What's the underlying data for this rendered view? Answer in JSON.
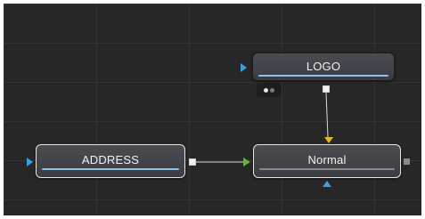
{
  "nodes": {
    "logo": {
      "label": "LOGO"
    },
    "address": {
      "label": "ADDRESS"
    },
    "normal": {
      "label": "Normal"
    }
  },
  "colors": {
    "canvas_bg": "#272727",
    "node_bg": "#3f4146",
    "selection_border": "#e6e6e6",
    "bar_blue": "#8fc2e6",
    "bar_gray": "#8a8a8a",
    "port_blue": "#3aa0e0",
    "port_green": "#5fb832",
    "port_yellow": "#e6b81f",
    "port_white": "#f2f2f2",
    "wire": "#d8d8d8"
  },
  "icons": {
    "input_blue": "triangle-right",
    "input_green": "triangle-right",
    "input_yellow": "triangle-down",
    "input_mask": "triangle-up",
    "output": "square",
    "badge_dots": "two-dots"
  }
}
